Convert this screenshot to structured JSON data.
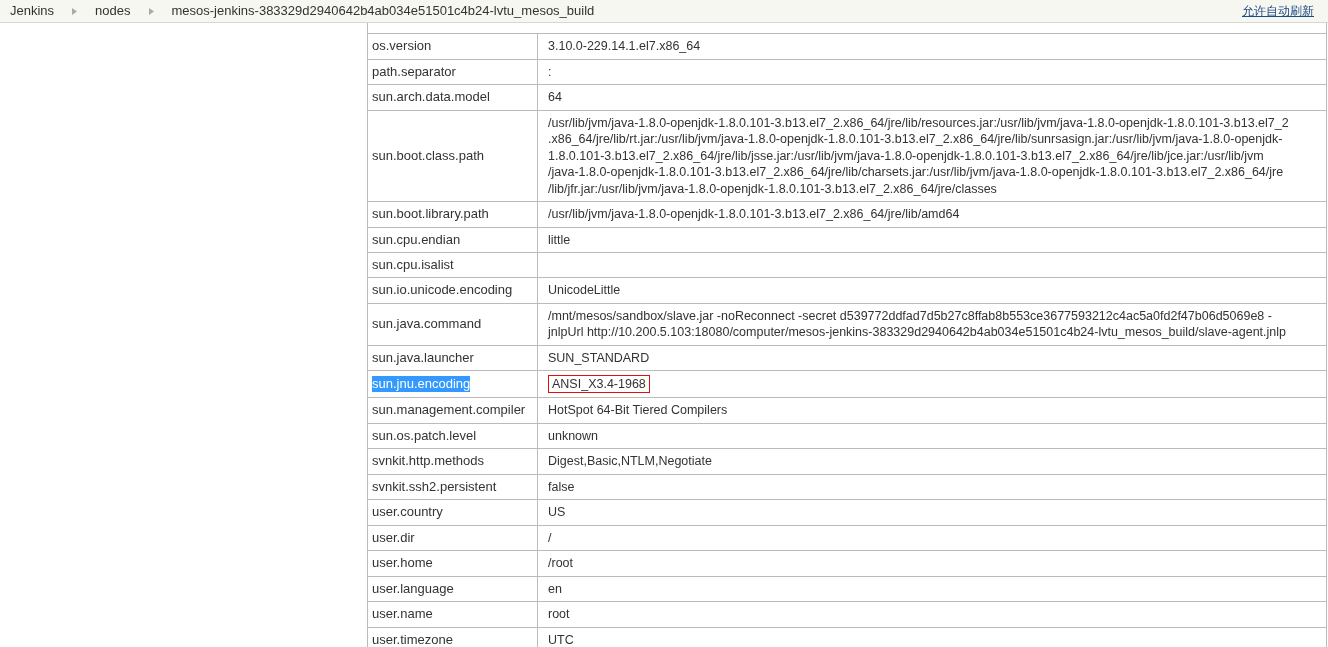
{
  "breadcrumbs": [
    "Jenkins",
    "nodes",
    "mesos-jenkins-383329d2940642b4ab034e51501c4b24-lvtu_mesos_build"
  ],
  "auto_refresh_link": "允许自动刷新",
  "properties": [
    {
      "key": "os.version",
      "lines": [
        "3.10.0-229.14.1.el7.x86_64"
      ]
    },
    {
      "key": "path.separator",
      "lines": [
        ":"
      ]
    },
    {
      "key": "sun.arch.data.model",
      "lines": [
        "64"
      ]
    },
    {
      "key": "sun.boot.class.path",
      "lines": [
        "/usr/lib/jvm/java-1.8.0-openjdk-1.8.0.101-3.b13.el7_2.x86_64/jre/lib/resources.jar:/usr/lib/jvm/java-1.8.0-openjdk-1.8.0.101-3.b13.el7_2",
        ".x86_64/jre/lib/rt.jar:/usr/lib/jvm/java-1.8.0-openjdk-1.8.0.101-3.b13.el7_2.x86_64/jre/lib/sunrsasign.jar:/usr/lib/jvm/java-1.8.0-openjdk-",
        "1.8.0.101-3.b13.el7_2.x86_64/jre/lib/jsse.jar:/usr/lib/jvm/java-1.8.0-openjdk-1.8.0.101-3.b13.el7_2.x86_64/jre/lib/jce.jar:/usr/lib/jvm",
        "/java-1.8.0-openjdk-1.8.0.101-3.b13.el7_2.x86_64/jre/lib/charsets.jar:/usr/lib/jvm/java-1.8.0-openjdk-1.8.0.101-3.b13.el7_2.x86_64/jre",
        "/lib/jfr.jar:/usr/lib/jvm/java-1.8.0-openjdk-1.8.0.101-3.b13.el7_2.x86_64/jre/classes"
      ]
    },
    {
      "key": "sun.boot.library.path",
      "lines": [
        "/usr/lib/jvm/java-1.8.0-openjdk-1.8.0.101-3.b13.el7_2.x86_64/jre/lib/amd64"
      ]
    },
    {
      "key": "sun.cpu.endian",
      "lines": [
        "little"
      ]
    },
    {
      "key": "sun.cpu.isalist"
    },
    {
      "key": "sun.io.unicode.encoding",
      "lines": [
        "UnicodeLittle"
      ]
    },
    {
      "key": "sun.java.command",
      "lines": [
        "/mnt/mesos/sandbox/slave.jar -noReconnect -secret d539772ddfad7d5b27c8ffab8b553ce3677593212c4ac5a0fd2f47b06d5069e8 -",
        "jnlpUrl http://10.200.5.103:18080/computer/mesos-jenkins-383329d2940642b4ab034e51501c4b24-lvtu_mesos_build/slave-agent.jnlp"
      ]
    },
    {
      "key": "sun.java.launcher",
      "lines": [
        "SUN_STANDARD"
      ]
    },
    {
      "key": "sun.jnu.encoding",
      "lines": [
        "ANSI_X3.4-1968"
      ],
      "highlighted": true,
      "boxed": true
    },
    {
      "key": "sun.management.compiler",
      "lines": [
        "HotSpot 64-Bit Tiered Compilers"
      ]
    },
    {
      "key": "sun.os.patch.level",
      "lines": [
        "unknown"
      ]
    },
    {
      "key": "svnkit.http.methods",
      "lines": [
        "Digest,Basic,NTLM,Negotiate"
      ]
    },
    {
      "key": "svnkit.ssh2.persistent",
      "lines": [
        "false"
      ]
    },
    {
      "key": "user.country",
      "lines": [
        "US"
      ]
    },
    {
      "key": "user.dir",
      "lines": [
        "/"
      ]
    },
    {
      "key": "user.home",
      "lines": [
        "/root"
      ]
    },
    {
      "key": "user.language",
      "lines": [
        "en"
      ]
    },
    {
      "key": "user.name",
      "lines": [
        "root"
      ]
    },
    {
      "key": "user.timezone",
      "lines": [
        "UTC"
      ]
    }
  ]
}
